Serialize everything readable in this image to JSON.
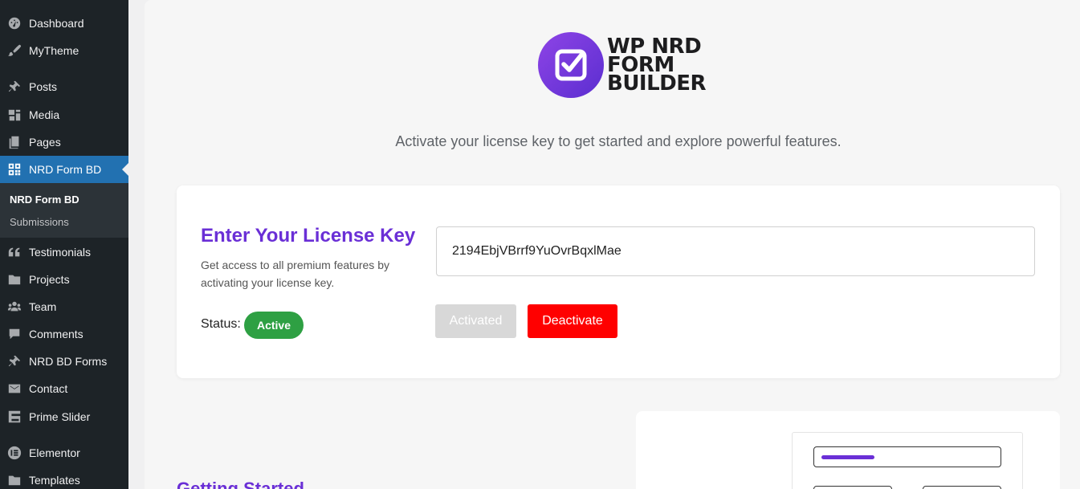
{
  "sidebar": {
    "items": [
      {
        "label": "Dashboard",
        "icon": "dashboard-icon"
      },
      {
        "label": "MyTheme",
        "icon": "brush-icon"
      },
      {
        "label": "Posts",
        "icon": "pin-icon"
      },
      {
        "label": "Media",
        "icon": "media-icon"
      },
      {
        "label": "Pages",
        "icon": "pages-icon"
      },
      {
        "label": "NRD Form BD",
        "icon": "grid-icon"
      },
      {
        "label": "Testimonials",
        "icon": "quote-icon"
      },
      {
        "label": "Projects",
        "icon": "folder-icon"
      },
      {
        "label": "Team",
        "icon": "team-icon"
      },
      {
        "label": "Comments",
        "icon": "comment-icon"
      },
      {
        "label": "NRD BD Forms",
        "icon": "pin-icon"
      },
      {
        "label": "Contact",
        "icon": "mail-icon"
      },
      {
        "label": "Prime Slider",
        "icon": "slider-icon"
      },
      {
        "label": "Elementor",
        "icon": "elementor-icon"
      },
      {
        "label": "Templates",
        "icon": "folder-icon"
      }
    ],
    "submenu": [
      {
        "label": "NRD Form BD"
      },
      {
        "label": "Submissions"
      }
    ]
  },
  "logo": {
    "line1": "WP NRD",
    "line2": "FORM",
    "line3": "BUILDER"
  },
  "subtitle": "Activate your license key to get started and explore powerful features.",
  "license": {
    "title": "Enter Your License Key",
    "description": "Get access to all premium features by activating your license key.",
    "status_label": "Status:",
    "status_value": "Active",
    "key_value": "2194EbjVBrrf9YuOvrBqxlMae",
    "activated_label": "Activated",
    "deactivate_label": "Deactivate"
  },
  "getting_started": {
    "title": "Getting Started"
  },
  "colors": {
    "accent": "#6a2fd6",
    "status_active": "#2ea043",
    "deactivate": "#ff0000",
    "wp_blue": "#2271b1"
  }
}
